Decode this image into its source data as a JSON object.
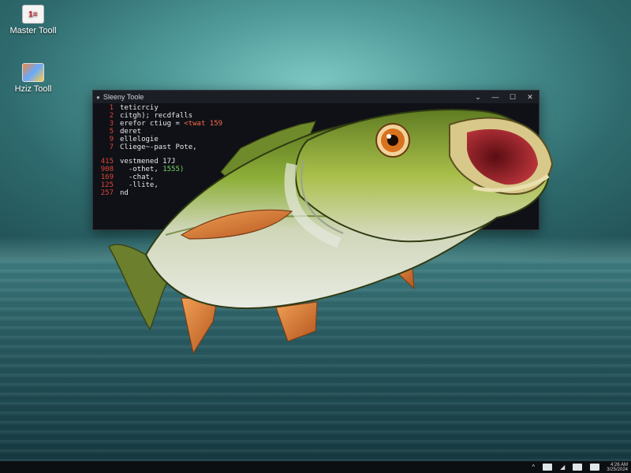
{
  "desktop": {
    "icons": [
      {
        "label": "Master Tooll",
        "glyph": "1≡"
      },
      {
        "label": "Hziz Tooll",
        "glyph": ""
      }
    ]
  },
  "terminal": {
    "title": "Sleeny Toole",
    "controls": {
      "chevron": "⌄",
      "minimize": "—",
      "maximize": "☐",
      "close": "✕"
    },
    "lines": [
      {
        "n": "1",
        "text": "teticrciy"
      },
      {
        "n": "2",
        "text": "citgh); recdfalls"
      },
      {
        "n": "3",
        "text": "erefor ctiug = ",
        "hl": "<twat 159"
      },
      {
        "n": "5",
        "text": "deret"
      },
      {
        "n": "9",
        "text": "ellelogie"
      },
      {
        "n": "7",
        "text": "Cliege~-past Pote,"
      },
      {
        "n": "",
        "text": ""
      },
      {
        "n": "415",
        "text": "vestmened 17J"
      },
      {
        "n": "908",
        "text": "  -othet, ",
        "grn": "1555)"
      },
      {
        "n": "169",
        "text": "  -chat, "
      },
      {
        "n": "125",
        "text": "  -llite,"
      },
      {
        "n": "257",
        "text": "nd"
      }
    ]
  },
  "taskbar": {
    "chevron": "^",
    "clock_line1": "4:26 AM",
    "clock_line2": "3/25/2024"
  },
  "colors": {
    "sky": "#5fa6a4",
    "water": "#23555a",
    "fish_green": "#7a9a2a",
    "fish_fin": "#d9772f"
  }
}
